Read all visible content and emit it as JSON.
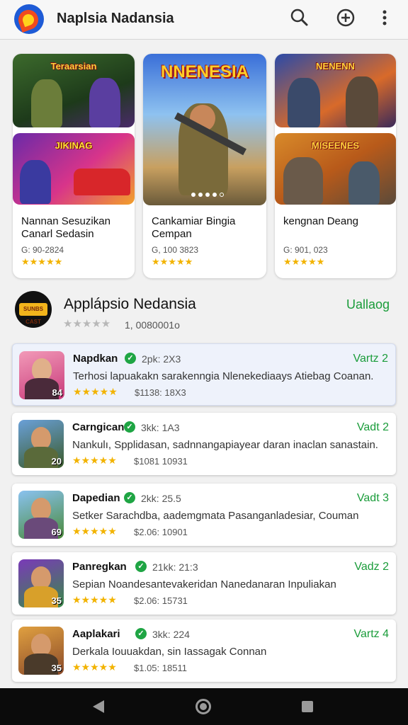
{
  "header": {
    "title": "Naplsia Nadansia",
    "icons": [
      "app-logo-icon",
      "search-icon",
      "add-circle-icon",
      "more-vert-icon"
    ]
  },
  "featured": {
    "thumbs": [
      "Teraarsian",
      "NNENESIA",
      "NENENN",
      "JIKINAG",
      "MISEENES"
    ],
    "cards": [
      {
        "name": "Nannan Sesuzikan Canarl Sedasin",
        "meta": "G: 90-2824",
        "stars": "★★★★★"
      },
      {
        "name": "Cankamiar Bingia Cempan",
        "meta": "G, 100 3823",
        "stars": "★★★★★"
      },
      {
        "name": "kengnan Deang",
        "meta": "G: 901, 023",
        "stars": "★★★★★"
      }
    ]
  },
  "section": {
    "icon_text": "SUNBS CAST",
    "title": "Applápsio Nedansia",
    "action": "Uallaog",
    "stars": "★★★★★",
    "count": "1, 0080001o"
  },
  "list": [
    {
      "name": "Napdkan",
      "size": "2pk: 2X3",
      "action": "Vartz 2",
      "desc": "Terhosi lapuakakn sarakenngia Nlenekediaays Atiebag Coanan.",
      "stars": "★★★★★",
      "price": "$1138: 18X3",
      "num": "84"
    },
    {
      "name": "Carngican",
      "size": "3kk: 1A3",
      "action": "Vadt 2",
      "desc": "Nankulı, Spplidasan, sadnnangapiayear daran inaclan sanastain.",
      "stars": "★★★★★",
      "price": "$1081 10931",
      "num": "20"
    },
    {
      "name": "Dapedian",
      "size": "2kk: 25.5",
      "action": "Vadt 3",
      "desc": "Setker Sarachdba, aademgmata Pasanganladesiar, Couman",
      "stars": "★★★★★",
      "price": "$2.06: 10901",
      "num": "69"
    },
    {
      "name": "Panregkan",
      "size": "21kk: 21:3",
      "action": "Vadz 2",
      "desc": "Sepian Noandesantevakeridan Nanedanaran Inpuliakan",
      "stars": "★★★★★",
      "price": "$2.06: 15731",
      "num": "35"
    },
    {
      "name": "Aaplakari",
      "size": "3kk: 224",
      "action": "Vartz 4",
      "desc": "Derkala Iouuakdan, sin Iassagak Connan",
      "stars": "★★★★★",
      "price": "$1.05: 18511",
      "num": "35"
    }
  ],
  "colors": {
    "accent_green": "#1a9c3a",
    "star": "#f2b300"
  }
}
